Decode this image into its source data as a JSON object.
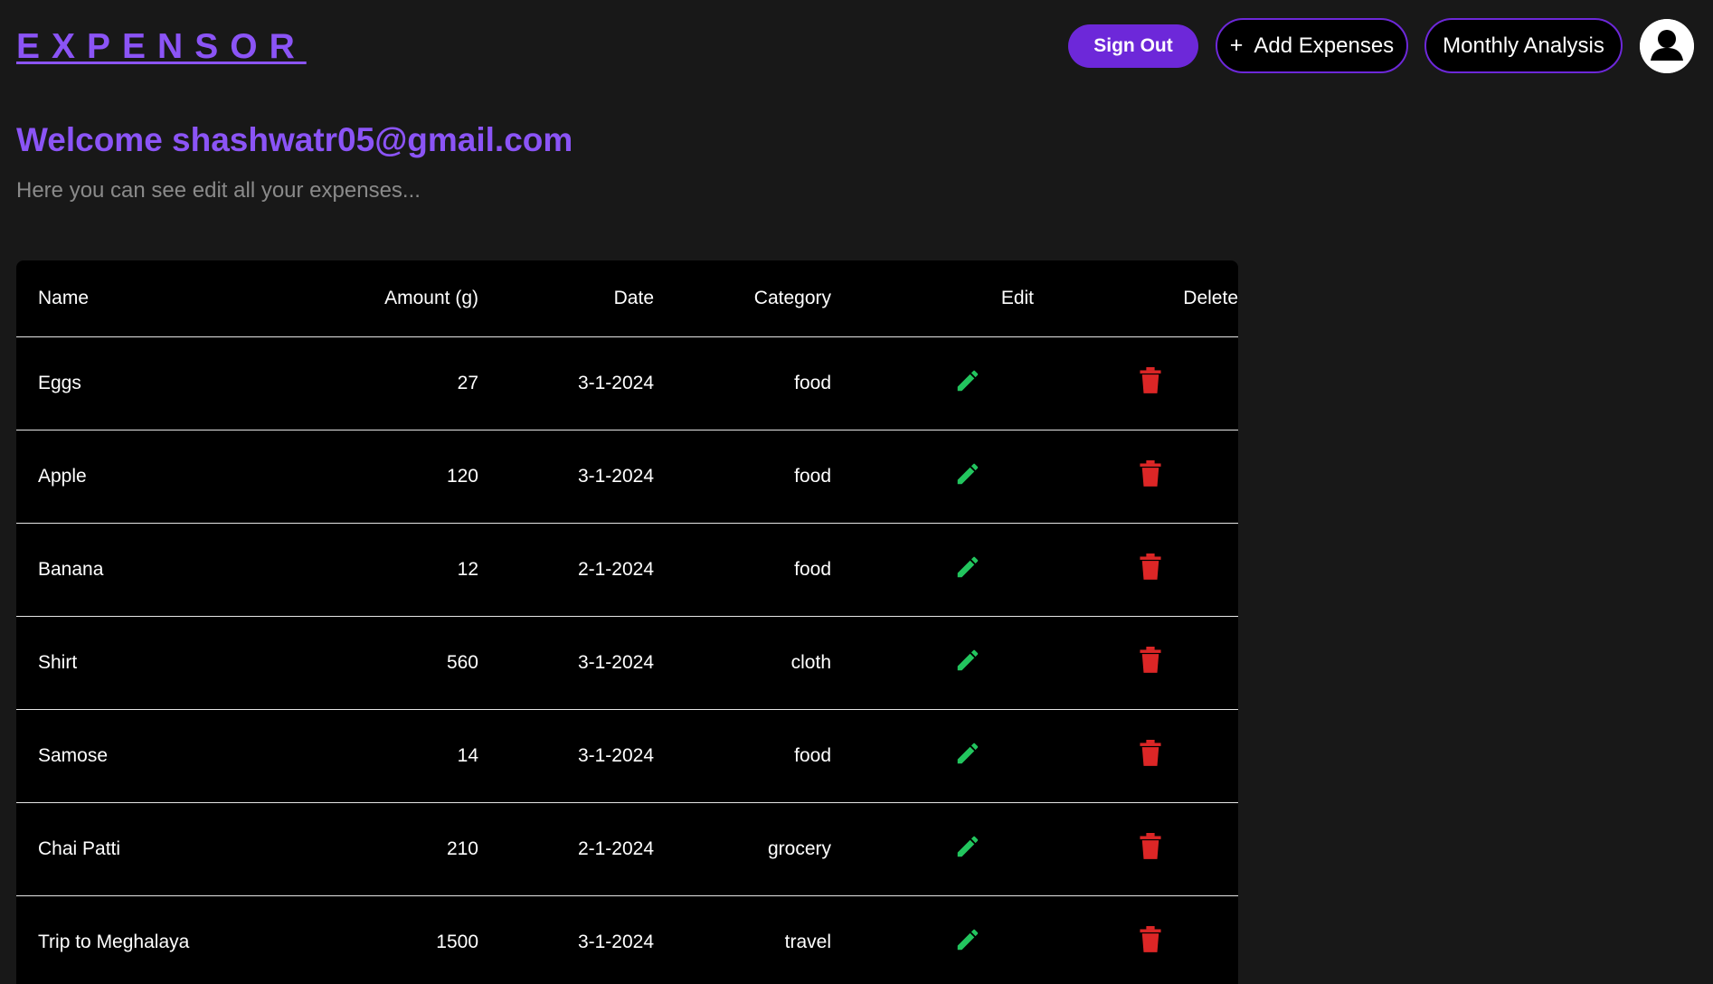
{
  "app": {
    "logo": "EXPENSOR"
  },
  "header": {
    "signout_label": "Sign Out",
    "add_expenses_label": "Add Expenses",
    "add_expenses_icon": "+",
    "monthly_analysis_label": "Monthly Analysis",
    "avatar_icon": "user-avatar-icon"
  },
  "main": {
    "welcome": "Welcome shashwatr05@gmail.com",
    "subtitle": "Here you can see edit all your expenses..."
  },
  "table": {
    "headers": {
      "name": "Name",
      "amount": "Amount (g)",
      "date": "Date",
      "category": "Category",
      "edit": "Edit",
      "delete": "Delete"
    },
    "rows": [
      {
        "name": "Eggs",
        "amount": "27",
        "date": "3-1-2024",
        "category": "food"
      },
      {
        "name": "Apple",
        "amount": "120",
        "date": "3-1-2024",
        "category": "food"
      },
      {
        "name": "Banana",
        "amount": "12",
        "date": "2-1-2024",
        "category": "food"
      },
      {
        "name": "Shirt",
        "amount": "560",
        "date": "3-1-2024",
        "category": "cloth"
      },
      {
        "name": "Samose",
        "amount": "14",
        "date": "3-1-2024",
        "category": "food"
      },
      {
        "name": "Chai Patti",
        "amount": "210",
        "date": "2-1-2024",
        "category": "grocery"
      },
      {
        "name": "Trip to Meghalaya",
        "amount": "1500",
        "date": "3-1-2024",
        "category": "travel"
      }
    ]
  },
  "colors": {
    "accent": "#8b54f6",
    "button": "#6d28d9",
    "edit_icon": "#22c55e",
    "delete_icon": "#dc2626"
  },
  "icons": {
    "edit": "pencil-icon",
    "delete": "trash-icon"
  }
}
